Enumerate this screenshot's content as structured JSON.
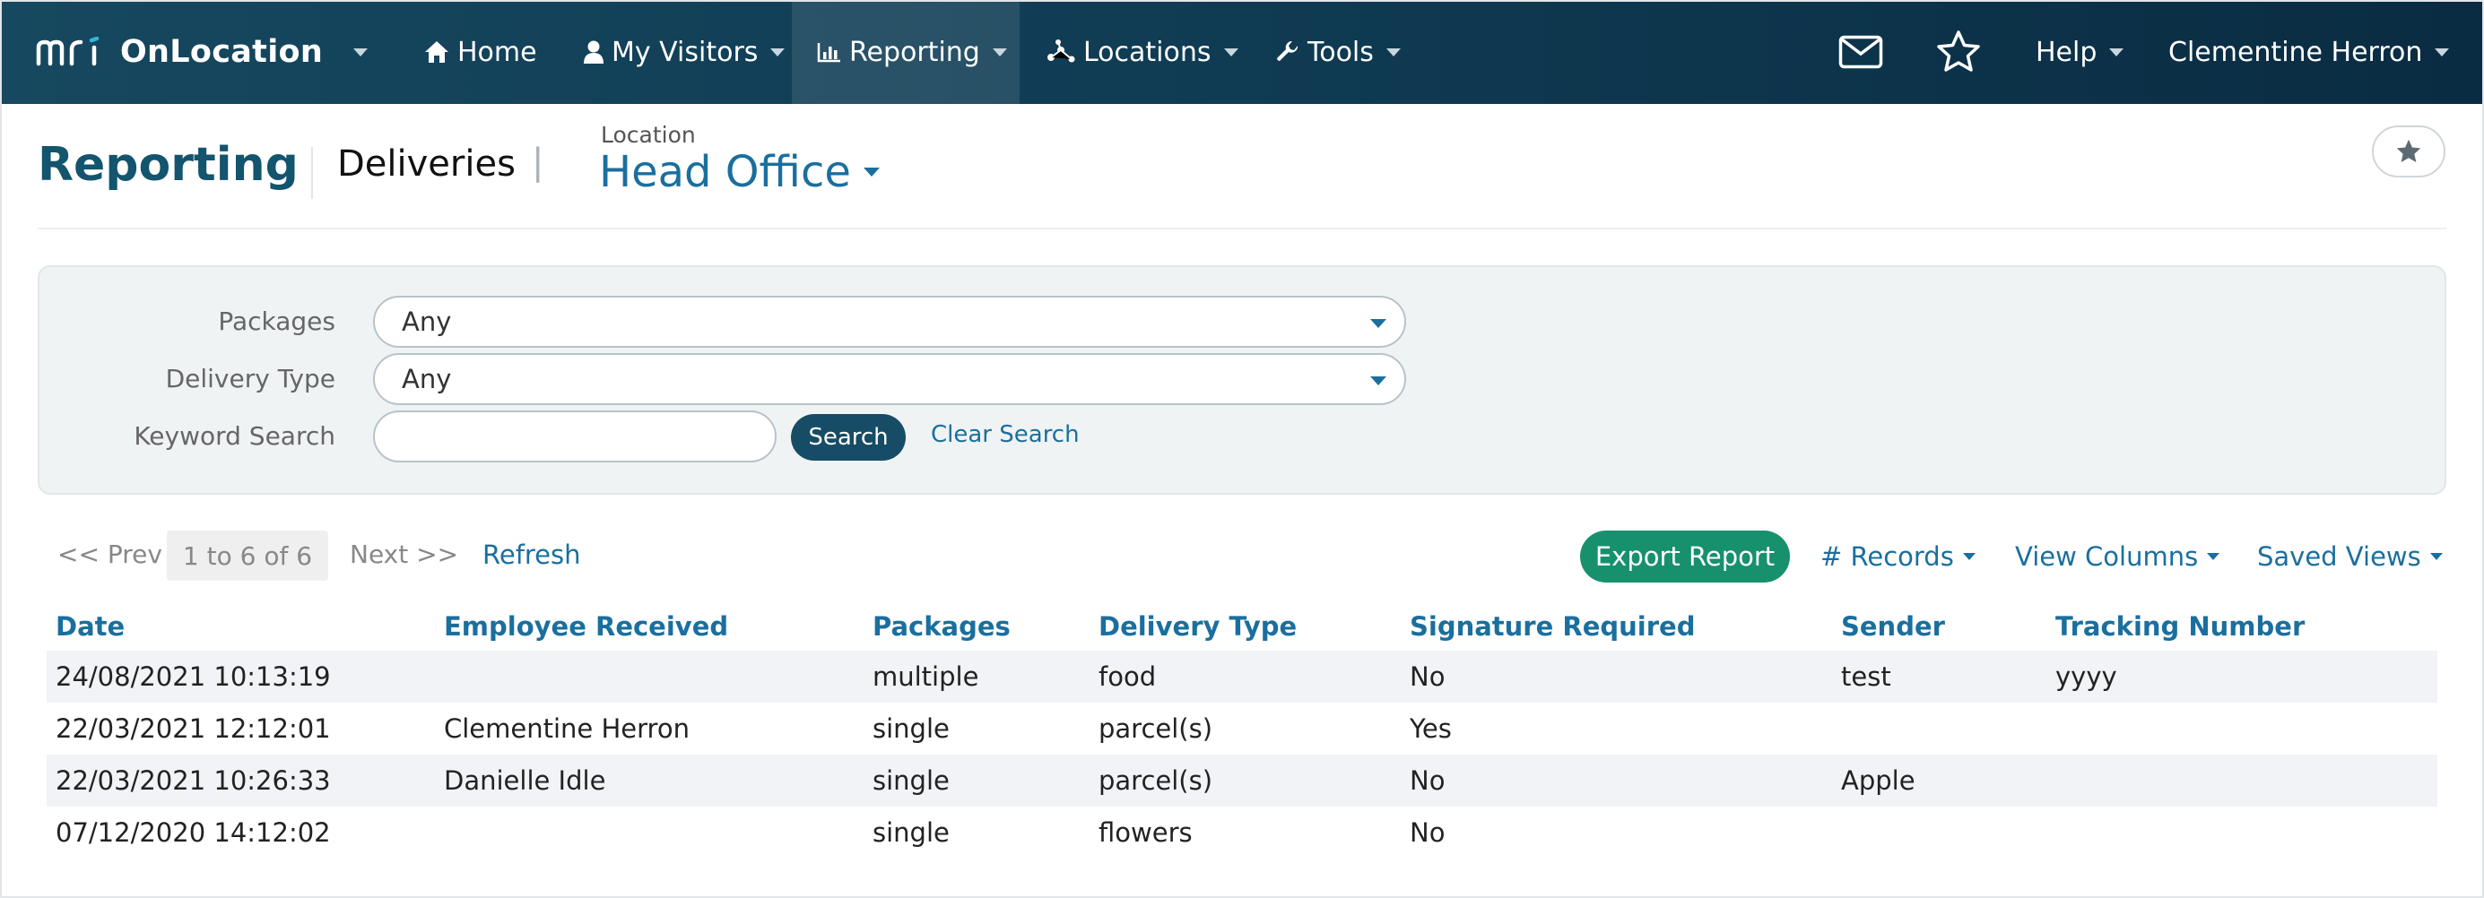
{
  "navbar": {
    "logo_text": "mri",
    "app_name": "OnLocation",
    "items": [
      {
        "label": "Home",
        "icon": "home-icon"
      },
      {
        "label": "My Visitors",
        "icon": "user-icon"
      },
      {
        "label": "Reporting",
        "icon": "bar-chart-icon"
      },
      {
        "label": "Locations",
        "icon": "network-icon"
      },
      {
        "label": "Tools",
        "icon": "wrench-icon"
      }
    ],
    "active_item": "Reporting",
    "help_label": "Help",
    "user_name": "Clementine Herron"
  },
  "header": {
    "title": "Reporting",
    "section": "Deliveries",
    "separator": "|",
    "location_label": "Location",
    "location_value": "Head Office"
  },
  "filters": {
    "packages_label": "Packages",
    "packages_value": "Any",
    "delivery_type_label": "Delivery Type",
    "delivery_type_value": "Any",
    "keyword_label": "Keyword Search",
    "keyword_value": "",
    "search_label": "Search",
    "clear_label": "Clear Search"
  },
  "toolbar": {
    "prev_label": "<< Prev",
    "range_label": "1 to 6 of 6",
    "next_label": "Next >>",
    "refresh_label": "Refresh",
    "export_label": "Export Report",
    "records_label": "# Records",
    "view_columns_label": "View Columns",
    "saved_views_label": "Saved Views"
  },
  "table": {
    "columns": [
      "Date",
      "Employee Received",
      "Packages",
      "Delivery Type",
      "Signature Required",
      "Sender",
      "Tracking Number"
    ],
    "rows": [
      [
        "24/08/2021 10:13:19",
        "",
        "multiple",
        "food",
        "No",
        "test",
        "yyyy"
      ],
      [
        "22/03/2021 12:12:01",
        "Clementine Herron",
        "single",
        "parcel(s)",
        "Yes",
        "",
        ""
      ],
      [
        "22/03/2021 10:26:33",
        "Danielle Idle",
        "single",
        "parcel(s)",
        "No",
        "Apple",
        ""
      ],
      [
        "07/12/2020 14:12:02",
        "",
        "single",
        "flowers",
        "No",
        "",
        ""
      ]
    ]
  },
  "colors": {
    "navbar": "#0f3b53",
    "title": "#13546e",
    "link": "#1a6f9e",
    "export": "#17906d",
    "search": "#164c65"
  }
}
